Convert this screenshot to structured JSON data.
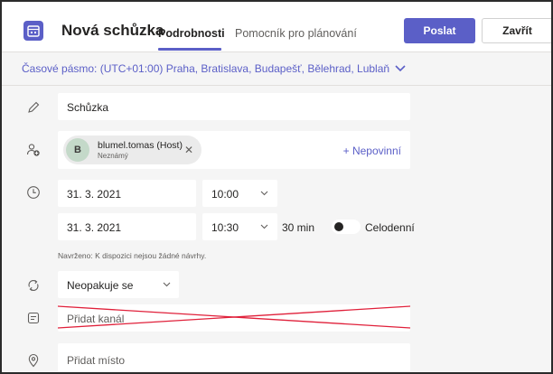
{
  "header": {
    "title": "Nová schůzka",
    "tabs": [
      {
        "label": "Podrobnosti",
        "active": true
      },
      {
        "label": "Pomocník pro plánování",
        "active": false
      }
    ],
    "send_label": "Poslat",
    "close_label": "Zavřít"
  },
  "timezone": {
    "label": "Časové pásmo: (UTC+01:00) Praha, Bratislava, Budapešť, Bělehrad, Lublaň"
  },
  "form": {
    "title_value": "Schůzka",
    "attendee": {
      "initial": "B",
      "name": "blumel.tomas (Host)",
      "status": "Neznámý"
    },
    "optional_label": "+ Nepovinní",
    "start_date": "31. 3. 2021",
    "start_time": "10:00",
    "end_date": "31. 3. 2021",
    "end_time": "10:30",
    "duration": "30 min",
    "allday_label": "Celodenní",
    "allday_on": false,
    "suggestion": "Navrženo: K dispozici nejsou žádné návrhy.",
    "repeat": "Neopakuje se",
    "channel_placeholder": "Přidat kanál",
    "location_placeholder": "Přidat místo"
  },
  "colors": {
    "accent": "#5b5fc7",
    "annotation": "#e0203a"
  }
}
